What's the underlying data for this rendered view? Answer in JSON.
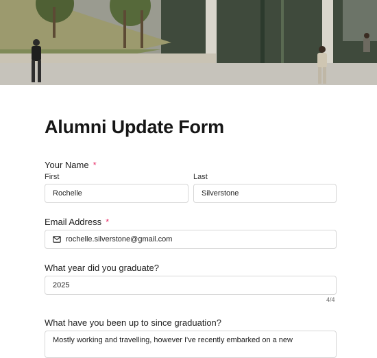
{
  "form": {
    "title": "Alumni Update Form",
    "name": {
      "label": "Your Name",
      "required_mark": "*",
      "first": {
        "label": "First",
        "value": "Rochelle"
      },
      "last": {
        "label": "Last",
        "value": "Silverstone"
      }
    },
    "email": {
      "label": "Email Address",
      "required_mark": "*",
      "value": "rochelle.silverstone@gmail.com",
      "icon": "mail-icon"
    },
    "grad_year": {
      "label": "What year did you graduate?",
      "value": "2025",
      "counter": "4/4"
    },
    "since_grad": {
      "label": "What have you been up to since graduation?",
      "value": "Mostly working and travelling, however I've recently embarked on a new"
    }
  },
  "colors": {
    "required": "#e8336b",
    "border": "#d6d6d6",
    "text": "#1f1f1f"
  }
}
